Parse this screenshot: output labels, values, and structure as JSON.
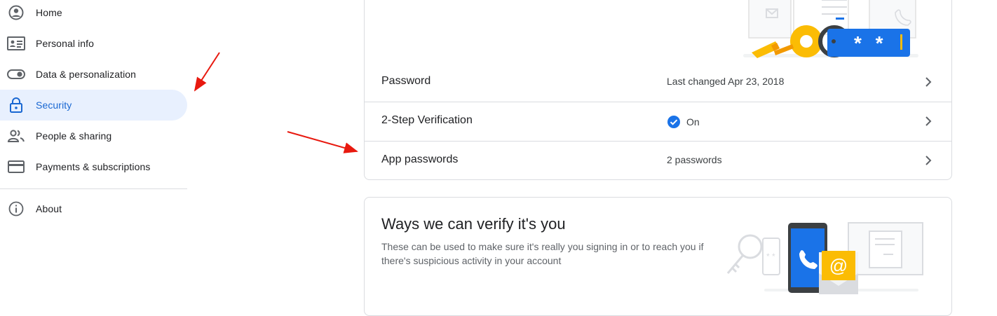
{
  "sidebar": {
    "items": [
      {
        "label": "Home",
        "icon": "account-circle-icon"
      },
      {
        "label": "Personal info",
        "icon": "id-card-icon"
      },
      {
        "label": "Data & personalization",
        "icon": "toggle-icon"
      },
      {
        "label": "Security",
        "icon": "lock-icon",
        "active": true
      },
      {
        "label": "People & sharing",
        "icon": "people-icon"
      },
      {
        "label": "Payments & subscriptions",
        "icon": "credit-card-icon"
      }
    ],
    "about": {
      "label": "About",
      "icon": "info-icon"
    }
  },
  "signin": {
    "rows": [
      {
        "label": "Password",
        "value": "Last changed Apr 23, 2018"
      },
      {
        "label": "2-Step Verification",
        "value": "On",
        "status_icon": "check-circle-icon"
      },
      {
        "label": "App passwords",
        "value": "2 passwords"
      }
    ]
  },
  "verify": {
    "title": "Ways we can verify it's you",
    "description": "These can be used to make sure it's really you signing in or to reach you if there's suspicious activity in your account"
  },
  "illustration": {
    "password_mask": "* *",
    "email_symbol": "@"
  },
  "colors": {
    "accent": "#1a73e8",
    "active_bg": "#e8f0fe",
    "active_text": "#1967d2",
    "annotation_arrow": "#e8190f"
  }
}
